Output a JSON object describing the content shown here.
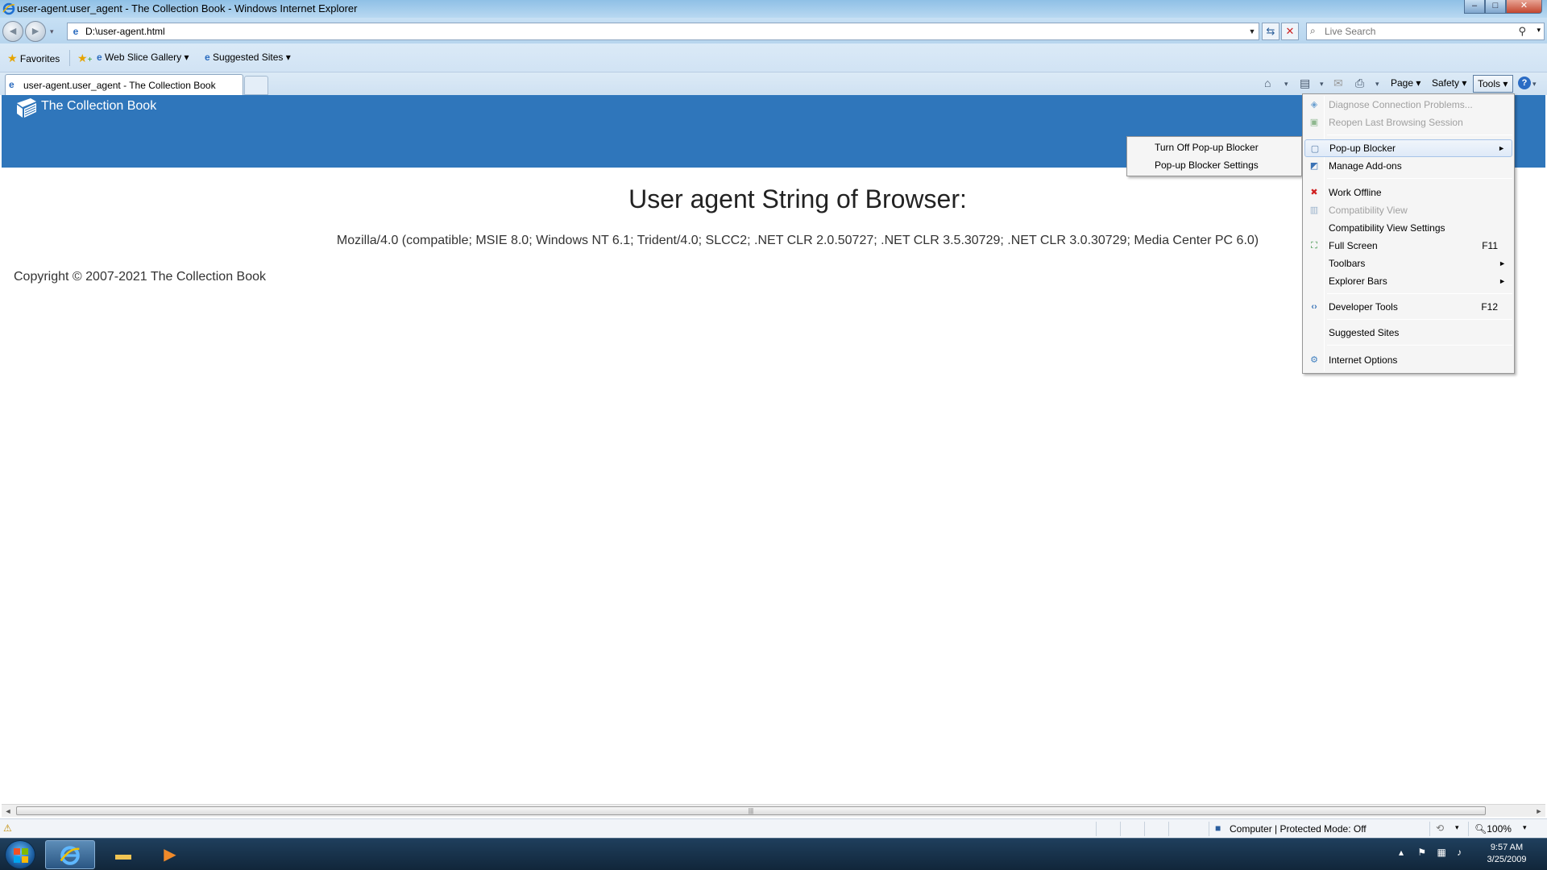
{
  "window": {
    "title": "user-agent.user_agent - The Collection Book - Windows Internet Explorer",
    "minimize_glyph": "–",
    "maximize_glyph": "□",
    "close_glyph": "✕"
  },
  "address_bar": {
    "url": "D:\\user-agent.html",
    "back_glyph": "◄",
    "forward_glyph": "►",
    "refresh_glyph": "⇆",
    "stop_glyph": "✕"
  },
  "search": {
    "placeholder": "Live Search",
    "search_icon": "magnifier-icon"
  },
  "favorites_bar": {
    "favorites_label": "Favorites",
    "items": [
      "Web Slice Gallery ▾",
      "Suggested Sites ▾"
    ]
  },
  "tabs": [
    {
      "label": "user-agent.user_agent - The Collection Book",
      "active": true
    }
  ],
  "command_bar": {
    "page_label": "Page ▾",
    "safety_label": "Safety ▾",
    "tools_label": "Tools ▾",
    "help_glyph": "?"
  },
  "page": {
    "brand": "The Collection Book",
    "heading": "User agent String of Browser:",
    "user_agent": "Mozilla/4.0 (compatible; MSIE 8.0; Windows NT 6.1; Trident/4.0; SLCC2; .NET CLR 2.0.50727; .NET CLR 3.5.30729; .NET CLR 3.0.30729; Media Center PC 6.0)",
    "copyright": "Copyright © 2007-2021 The Collection Book",
    "header_color": "#2f76bb"
  },
  "tools_menu": {
    "items": [
      {
        "label": "Diagnose Connection Problems...",
        "disabled": true,
        "icon": "network-icon"
      },
      {
        "label": "Reopen Last Browsing Session",
        "disabled": true,
        "icon": "reopen-icon"
      },
      {
        "label": "Pop-up Blocker",
        "submenu": true,
        "highlighted": true,
        "icon": "popup-icon"
      },
      {
        "label": "Manage Add-ons",
        "icon": "addons-icon"
      },
      {
        "label": "Work Offline",
        "icon": "offline-icon"
      },
      {
        "label": "Compatibility View",
        "disabled": true,
        "icon": "compat-icon"
      },
      {
        "label": "Compatibility View Settings"
      },
      {
        "label": "Full Screen",
        "shortcut": "F11",
        "icon": "fullscreen-icon"
      },
      {
        "label": "Toolbars",
        "submenu": true
      },
      {
        "label": "Explorer Bars",
        "submenu": true
      },
      {
        "label": "Developer Tools",
        "shortcut": "F12",
        "icon": "devtools-icon"
      },
      {
        "label": "Suggested Sites"
      },
      {
        "label": "Internet Options",
        "icon": "options-icon"
      }
    ]
  },
  "popup_submenu": {
    "items": [
      "Turn Off Pop-up Blocker",
      "Pop-up Blocker Settings"
    ]
  },
  "status_bar": {
    "zone": "Computer | Protected Mode: Off",
    "zoom": "100%"
  },
  "taskbar": {
    "time": "9:57 AM",
    "date": "3/25/2009"
  }
}
